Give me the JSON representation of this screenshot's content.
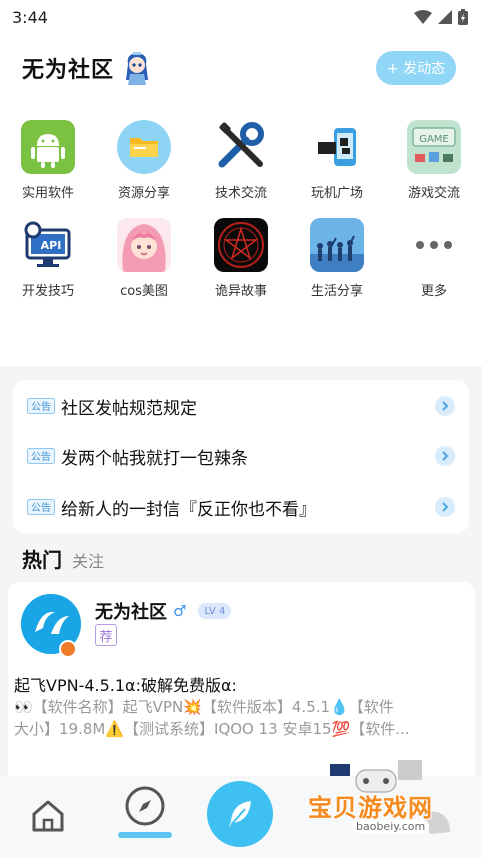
{
  "status_bar": {
    "time": "3:44"
  },
  "header": {
    "title": "无为社区",
    "post_button": "+ 发动态"
  },
  "grid": [
    {
      "label": "实用软件",
      "icon": "android-icon"
    },
    {
      "label": "资源分享",
      "icon": "folder-icon"
    },
    {
      "label": "技术交流",
      "icon": "tools-icon"
    },
    {
      "label": "玩机广场",
      "icon": "phone-icon"
    },
    {
      "label": "游戏交流",
      "icon": "game-icon"
    },
    {
      "label": "开发技巧",
      "icon": "api-icon"
    },
    {
      "label": "cos美图",
      "icon": "anime-avatar-icon"
    },
    {
      "label": "诡异故事",
      "icon": "pentagram-icon"
    },
    {
      "label": "生活分享",
      "icon": "people-icon"
    },
    {
      "label": "更多",
      "icon": "more-icon"
    }
  ],
  "notices": [
    {
      "tag": "公告",
      "text": "社区发帖规范规定"
    },
    {
      "tag": "公告",
      "text": "发两个帖我就打一包辣条"
    },
    {
      "tag": "公告",
      "text": "给新人的一封信『反正你也不看』"
    }
  ],
  "tabs": {
    "hot": "热门",
    "follow": "关注"
  },
  "post": {
    "author": "无为社区",
    "gender": "♂",
    "level": "LV 4",
    "tag": "荐",
    "title": "起飞VPN-4.5.1α:破解免费版α:",
    "body_line1": "👀【软件名称】起飞VPN💥【软件版本】4.5.1💧【软件",
    "body_line2": "大小】19.8M⚠️【测试系统】IQOO 13 安卓15💯【软件..."
  },
  "watermark": {
    "text": "宝贝游戏网",
    "url": "baobeiy.com"
  },
  "colors": {
    "accent": "#3ec0f2",
    "post_button": "#8fd6f7"
  }
}
